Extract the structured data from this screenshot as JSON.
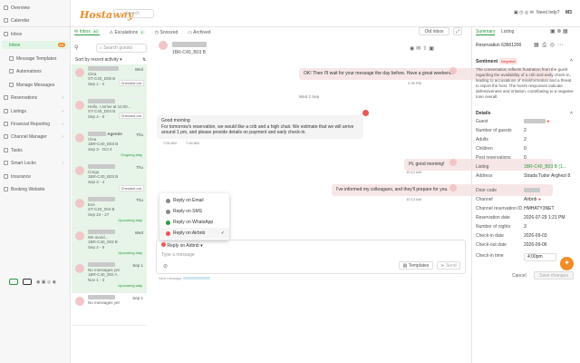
{
  "app": {
    "logo": "Hostaway",
    "search_placeholder": "Search",
    "need_help": "Need help?",
    "user_initials": "M3"
  },
  "sidebar": {
    "items": [
      {
        "label": "Overview"
      },
      {
        "label": "Calendar"
      },
      {
        "label": "Inbox"
      },
      {
        "label": "Inbox",
        "badge": "40"
      },
      {
        "label": "Message Templates"
      },
      {
        "label": "Automations"
      },
      {
        "label": "Manage Messages"
      },
      {
        "label": "Reservations"
      },
      {
        "label": "Listings"
      },
      {
        "label": "Financial Reporting"
      },
      {
        "label": "Channel Manager"
      },
      {
        "label": "Tasks"
      },
      {
        "label": "Smart Locks"
      },
      {
        "label": "Insurance"
      },
      {
        "label": "Booking Website"
      }
    ]
  },
  "inbox": {
    "tabs": [
      {
        "label": "Inbox",
        "count": "40"
      },
      {
        "label": "Escalations",
        "count": "1"
      },
      {
        "label": "Snoozed"
      },
      {
        "label": "Archived"
      }
    ],
    "filter_label": "Filter",
    "search_placeholder": "Search guests",
    "sort_label": "Sort by recent activity"
  },
  "conversations": [
    {
      "preview": "Clea",
      "day": "Wed",
      "line3": "ST-C40_D06 B",
      "dates": "Sep 1 - 2",
      "status": "Checked out"
    },
    {
      "preview": "Hello, I arrive at 11:00...",
      "day": "",
      "line3": "ST-C40_D04 B",
      "dates": "Sep 4 - 5",
      "status": "Checked out"
    },
    {
      "name": "Agentie",
      "preview": "Clea",
      "day": "Thu",
      "line3": "1BR-C40_B03 B",
      "dates": "Sep 3 - Oct 4",
      "status": "Ongoing stay"
    },
    {
      "preview": "Cregu",
      "day": "Thu",
      "line3": "1BR-C40_B03 B",
      "dates": "Sep 3 - 4",
      "status": "Checked out"
    },
    {
      "preview": "Exe",
      "day": "Thu",
      "line3": "ST-C40_004 B",
      "dates": "Sep 24 - 27",
      "status": "Upcoming stay"
    },
    {
      "preview": "We avoid...",
      "day": "Wed",
      "line3": "1BR-C40_003 B",
      "dates": "Sep 4 - 6",
      "status": "Upcoming stay"
    },
    {
      "preview": "No messages yet",
      "day": "Sep 1",
      "line3": "1BR-C40_002 A",
      "dates": "Nov 1 - 3",
      "status": "Upcoming stay"
    },
    {
      "preview": "No messages yet",
      "day": "Sep 1",
      "line3": "",
      "dates": "",
      "status": ""
    }
  ],
  "chat": {
    "listing": "1BR-C40_B03 B",
    "thread_btn": "Old inbox",
    "messages": [
      {
        "dir": "out",
        "text": "OK! Then I'll wait for your message the day before. Have a great weekend.",
        "time": "2:26 PM"
      },
      {
        "dir": "date",
        "text": "Wed 2 Sep"
      },
      {
        "dir": "in",
        "text": "Good morning\nFor tomorrow's reservation, we would like a crib and a high chair. We estimate that we will arrive around 1 pm, and please provide details on payment and early check-in.",
        "time": "7:00 AM",
        "time2": "7:44 AM"
      },
      {
        "dir": "out",
        "text": "Hi, good morning!",
        "time": "10:12 AM"
      },
      {
        "dir": "out",
        "text": "I've informed my colleagues, and they'll prepare for you.",
        "time": "10:13 AM"
      }
    ],
    "reply_menu": [
      {
        "label": "Reply on Email"
      },
      {
        "label": "Reply on SMS"
      },
      {
        "label": "Reply on WhatsApp"
      },
      {
        "label": "Reply on Airbnb"
      }
    ],
    "reply_via": "Reply on Airbnb",
    "compose_placeholder": "Type a message",
    "templates_btn": "Templates",
    "send_btn": "Send",
    "footer": "Sent message"
  },
  "summary": {
    "tabs": [
      {
        "label": "Summary"
      },
      {
        "label": "Listing"
      }
    ],
    "reservation": "Reservation 63661200",
    "sentiment_title": "Sentiment",
    "sentiment_badge": "Negative",
    "sentiment_text": "The conversation reflects frustration from the guest regarding the availability of a crib and early check-in, leading to accusations of misinformation and a threat to report the host. The host's responses indicate defensiveness and irritation, contributing to a negative tone overall.",
    "details_title": "Details",
    "details": [
      {
        "k": "Guest",
        "v": ""
      },
      {
        "k": "Number of guests",
        "v": "2"
      },
      {
        "k": "Adults",
        "v": "2"
      },
      {
        "k": "Children",
        "v": "0"
      },
      {
        "k": "Pest reservations",
        "v": "0"
      },
      {
        "k": "Listing",
        "v": "1BR-C40_B03 B (1..."
      },
      {
        "k": "Address",
        "v": "Strada Tudor Arghezi 8"
      },
      {
        "k": "Door code",
        "v": ""
      },
      {
        "k": "Channel",
        "v": "Airbnb"
      },
      {
        "k": "Channel reservation ID",
        "v": "HMHATY3NET"
      },
      {
        "k": "Reservation date",
        "v": "2026-07-29 1:21 PM"
      },
      {
        "k": "Number of nights",
        "v": "3"
      },
      {
        "k": "Check-in date",
        "v": "2026-09-03"
      },
      {
        "k": "Check-out date",
        "v": "2026-09-06"
      },
      {
        "k": "Check-in time",
        "v": "4:00pm"
      }
    ],
    "cancel_btn": "Cancel",
    "save_btn": "Save changes"
  },
  "colors": {
    "accent": "#2c9a3f",
    "brand": "#f28c28",
    "out_bubble": "#f7e6e6"
  }
}
